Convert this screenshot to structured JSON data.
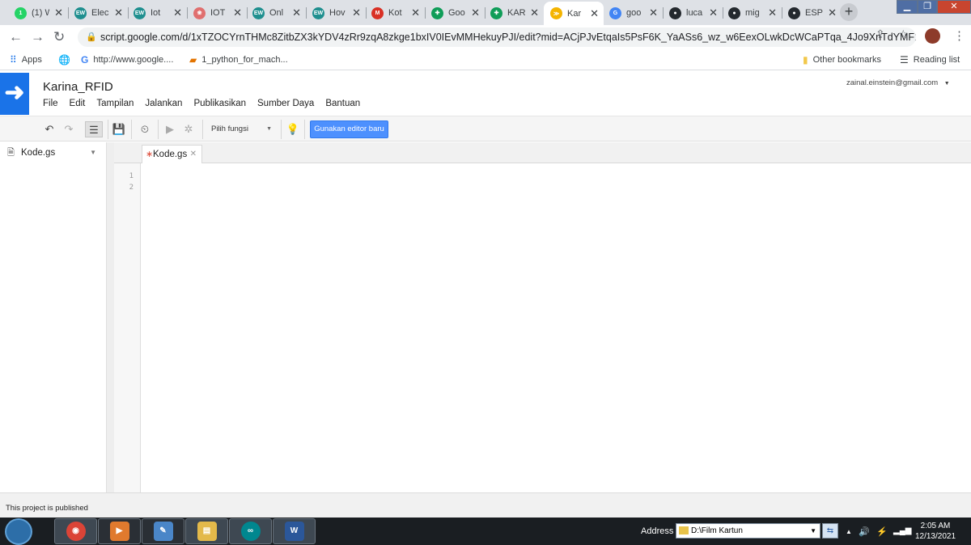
{
  "browser": {
    "tabs": [
      {
        "label": "(1) W",
        "favicon": "whatsapp-icon",
        "color": "#25d366",
        "glyph": "1"
      },
      {
        "label": "Elec",
        "favicon": "ew-icon",
        "color": "#1f8f8f",
        "glyph": "EW"
      },
      {
        "label": "Iot",
        "favicon": "ew-icon",
        "color": "#1f8f8f",
        "glyph": "EW"
      },
      {
        "label": "IOT",
        "favicon": "iot-icon",
        "color": "#e06f6f",
        "glyph": "❀"
      },
      {
        "label": "Onl",
        "favicon": "ew-icon",
        "color": "#1f8f8f",
        "glyph": "EW"
      },
      {
        "label": "Hov",
        "favicon": "ew-icon",
        "color": "#1f8f8f",
        "glyph": "EW"
      },
      {
        "label": "Kot",
        "favicon": "gmail-icon",
        "color": "#d93025",
        "glyph": "M"
      },
      {
        "label": "Goo",
        "favicon": "sheets-icon",
        "color": "#0f9d58",
        "glyph": "✚"
      },
      {
        "label": "KAR",
        "favicon": "sheets-icon",
        "color": "#0f9d58",
        "glyph": "✚"
      },
      {
        "label": "Kar",
        "favicon": "apps-script-icon",
        "color": "#f4b400",
        "glyph": "≫"
      },
      {
        "label": "goo",
        "favicon": "google-icon",
        "color": "#4285f4",
        "glyph": "G"
      },
      {
        "label": "luca",
        "favicon": "github-icon",
        "color": "#24292e",
        "glyph": "●"
      },
      {
        "label": "mig",
        "favicon": "github-icon",
        "color": "#24292e",
        "glyph": "●"
      },
      {
        "label": "ESP",
        "favicon": "github-icon",
        "color": "#24292e",
        "glyph": "●"
      }
    ],
    "active_tab_index": 9,
    "url": "script.google.com/d/1xTZOCYrnTHMc8ZitbZX3kYDV4zRr9zqA8zkge1bxIV0IEvMMHekuyPJI/edit?mid=ACjPJvEtqaIs5PsF6K_YaASs6_wz_w6EexOLwkDcWCaPTqa_4Jo9XnTdYMF1...",
    "bookmarks": {
      "apps": "Apps",
      "items": [
        "http://www.google....",
        "1_python_for_mach..."
      ],
      "other": "Other bookmarks",
      "reading_list": "Reading list"
    }
  },
  "editor": {
    "project_title": "Karina_RFID",
    "menu": [
      "File",
      "Edit",
      "Tampilan",
      "Jalankan",
      "Publikasikan",
      "Sumber Daya",
      "Bantuan"
    ],
    "account": "zainal.einstein@gmail.com",
    "function_select": "Pilih fungsi",
    "new_editor_button": "Gunakan editor baru",
    "files": [
      "Kode.gs"
    ],
    "open_tab": "Kode.gs",
    "line_numbers": [
      "1",
      "2"
    ],
    "status": "This project is published",
    "accent_color": "#4d90fe"
  },
  "taskbar": {
    "address_label": "Address",
    "address_value": "D:\\Film Kartun",
    "time": "2:05 AM",
    "date": "12/13/2021"
  }
}
